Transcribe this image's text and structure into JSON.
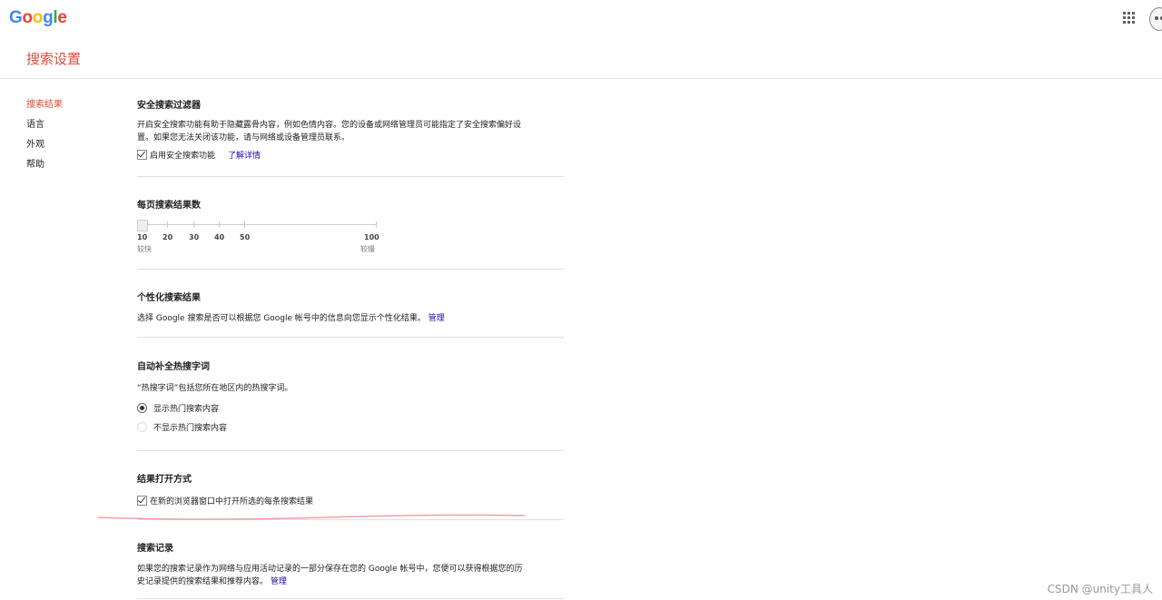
{
  "header": {
    "logo": [
      "G",
      "o",
      "o",
      "g",
      "l",
      "e"
    ],
    "apps_icon": "apps-grid-icon",
    "avatar_icon": "account-avatar-icon"
  },
  "page_title": "搜索设置",
  "sidebar": {
    "items": [
      {
        "label": "搜索结果",
        "active": true
      },
      {
        "label": "语言",
        "active": false
      },
      {
        "label": "外观",
        "active": false
      },
      {
        "label": "帮助",
        "active": false
      }
    ]
  },
  "safe_search": {
    "title": "安全搜索过滤器",
    "description_line1": "开启安全搜索功能有助于隐藏露骨内容，例如色情内容。您的设备或网络管理员可能指定了安全搜索偏好设",
    "description_line2": "置。如果您无法关闭该功能，请与网络或设备管理员联系。",
    "checkbox_label": "启用安全搜索功能",
    "checked": true,
    "learn_more": "了解详情"
  },
  "results_per_page": {
    "title": "每页搜索结果数",
    "ticks": [
      "10",
      "20",
      "30",
      "40",
      "50",
      "100"
    ],
    "selected": 10,
    "fast_label": "较快",
    "slow_label": "较慢"
  },
  "personal": {
    "title": "个性化搜索结果",
    "description": "选择 Google 搜索是否可以根据您 Google 帐号中的信息向您显示个性化结果。",
    "manage_link": "管理"
  },
  "trending": {
    "title": "自动补全热搜字词",
    "description": "“热搜字词”包括您所在地区内的热搜字词。",
    "options": [
      {
        "label": "显示热门搜索内容",
        "selected": true
      },
      {
        "label": "不显示热门搜索内容",
        "selected": false
      }
    ]
  },
  "open_results": {
    "title": "结果打开方式",
    "checkbox_label": "在新的浏览器窗口中打开所选的每条搜索结果",
    "checked": true
  },
  "history": {
    "title": "搜索记录",
    "description_line1": "如果您的搜索记录作为网络与应用活动记录的一部分保存在您的 Google 帐号中，您便可以获得根据您的历",
    "description_line2": "史记录提供的搜索结果和推荐内容。",
    "manage_link": "管理"
  },
  "colors": {
    "accent": "#dd4b39",
    "link": "#1a0dab",
    "annotation": "#f0a0a0"
  },
  "watermark": "CSDN @unity工具人"
}
